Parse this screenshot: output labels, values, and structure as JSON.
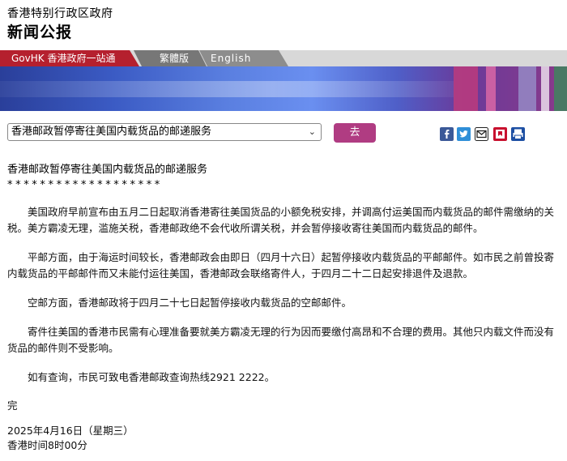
{
  "header": {
    "gov_name": "香港特别行政区政府",
    "page_type": "新闻公报"
  },
  "nav": {
    "govhk": "GovHK 香港政府一站通",
    "traditional": "繁體版",
    "english": "English"
  },
  "selector": {
    "selected": "香港邮政暂停寄往美国内载货品的邮递服务",
    "go_label": "去"
  },
  "share_icons": [
    "facebook-icon",
    "twitter-icon",
    "email-icon",
    "bookmark-icon",
    "print-icon"
  ],
  "article": {
    "title": "香港邮政暂停寄往美国内载货品的邮递服务",
    "stars": "*******************",
    "paragraphs": [
      "美国政府早前宣布由五月二日起取消香港寄往美国货品的小额免税安排，并调高付运美国而内载货品的邮件需缴纳的关税。美方霸凌无理，滥施关税，香港邮政绝不会代收所谓关税，并会暂停接收寄往美国而内载货品的邮件。",
      "平邮方面，由于海运时间较长，香港邮政会由即日（四月十六日）起暂停接收内载货品的平邮邮件。如市民之前曾投寄内载货品的平邮邮件而又未能付运往美国，香港邮政会联络寄件人，于四月二十二日起安排退件及退款。",
      "空邮方面，香港邮政将于四月二十七日起暂停接收内载货品的空邮邮件。",
      "寄件往美国的香港市民需有心理准备要就美方霸凌无理的行为因而要缴付高昂和不合理的费用。其他只内载文件而没有货品的邮件则不受影响。",
      "如有查询，市民可致电香港邮政查询热线2921 2222。"
    ],
    "end_mark": "完",
    "date": "2025年4月16日（星期三）",
    "time": "香港时间8时00分"
  },
  "colors": {
    "brand_red": "#b5202e",
    "go_button": "#b03c82",
    "banner_blue": "#3b5bc4"
  }
}
